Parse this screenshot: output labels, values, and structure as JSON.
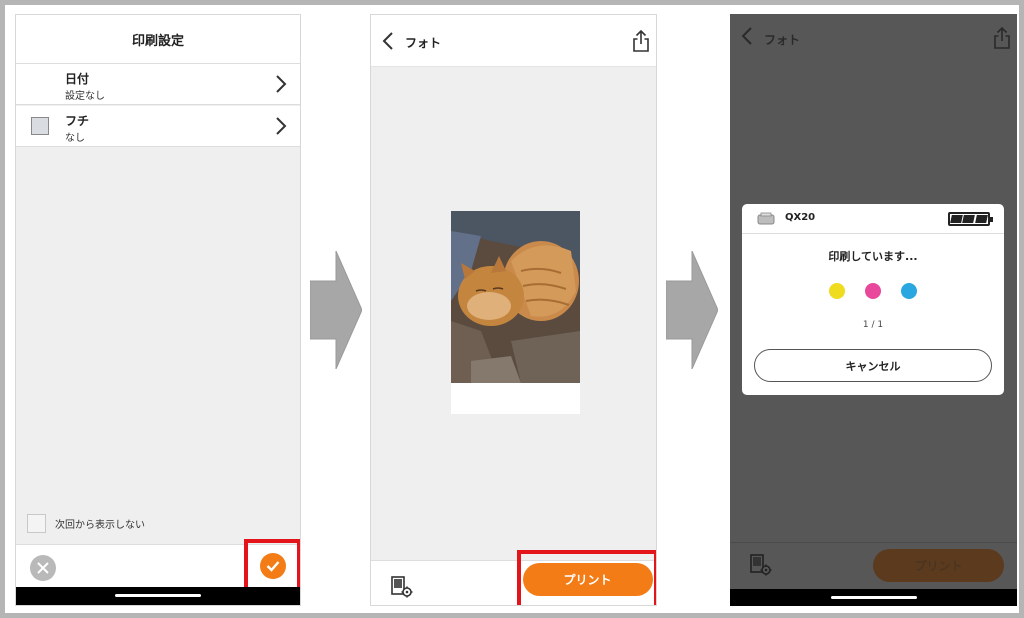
{
  "settings_screen": {
    "title": "印刷設定",
    "items": [
      {
        "title": "日付",
        "value": "設定なし"
      },
      {
        "title": "フチ",
        "value": "なし"
      }
    ],
    "dont_show_label": "次回から表示しない",
    "cancel_icon": "close-icon",
    "confirm_icon": "checkmark-icon"
  },
  "preview_screen": {
    "title": "フォト",
    "print_label": "プリント",
    "settings_icon": "print-settings-icon",
    "share_icon": "share-icon"
  },
  "printing_screen": {
    "title": "フォト",
    "device_name": "QX20",
    "status": "印刷しています...",
    "progress": "1 / 1",
    "cancel_label": "キャンセル",
    "print_label": "プリント",
    "ink_colors": [
      "#f0dc1f",
      "#e8479c",
      "#2aa7e0"
    ]
  },
  "colors": {
    "accent": "#f47c16",
    "highlight": "#e3151a"
  }
}
